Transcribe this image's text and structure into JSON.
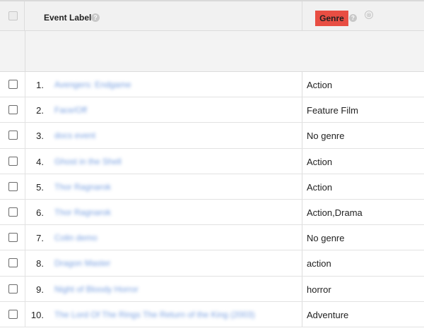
{
  "header": {
    "event_label": "Event Label",
    "help_icon": "?",
    "genre": "Genre",
    "remove_icon": "⊗"
  },
  "colors": {
    "genre_badge": "#e84e43",
    "link": "#4a7fd6"
  },
  "rows": [
    {
      "index": "1.",
      "label": "Avengers: Endgame",
      "genre": "Action"
    },
    {
      "index": "2.",
      "label": "Face/Off",
      "genre": "Feature Film"
    },
    {
      "index": "3.",
      "label": "docs event",
      "genre": "No genre"
    },
    {
      "index": "4.",
      "label": "Ghost in the Shell",
      "genre": "Action"
    },
    {
      "index": "5.",
      "label": "Thor Ragnarok",
      "genre": "Action"
    },
    {
      "index": "6.",
      "label": "Thor Ragnarok",
      "genre": "Action,Drama"
    },
    {
      "index": "7.",
      "label": "Colin demo",
      "genre": "No genre"
    },
    {
      "index": "8.",
      "label": "Dragon Master",
      "genre": "action"
    },
    {
      "index": "9.",
      "label": "Night of Bloody Horror",
      "genre": "horror"
    },
    {
      "index": "10.",
      "label": "The Lord Of The Rings The Return of the King (2003)",
      "genre": "Adventure"
    }
  ]
}
